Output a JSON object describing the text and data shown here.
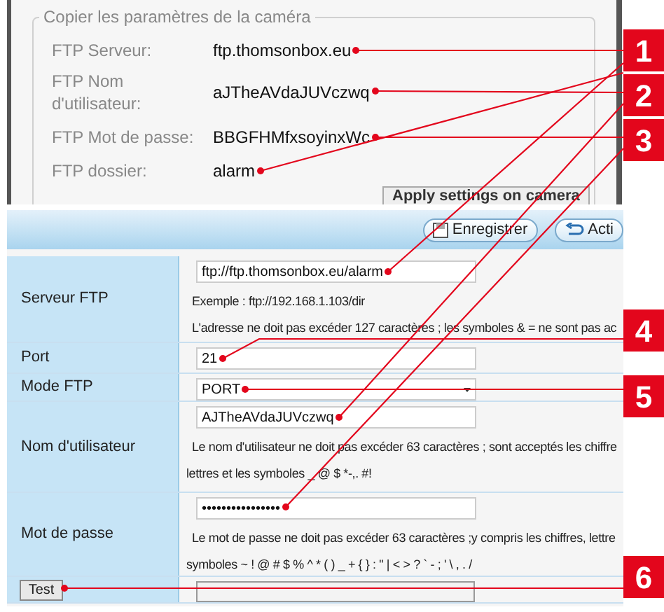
{
  "copy_panel": {
    "legend": "Copier les paramètres de la caméra",
    "rows": [
      {
        "label": "FTP Serveur:",
        "value": "ftp.thomsonbox.eu"
      },
      {
        "label": "FTP Nom d'utilisateur:",
        "value": "aJTheAVdaJUVczwq"
      },
      {
        "label": "FTP Mot de passe:",
        "value": "BBGFHMfxsoyinxWc"
      },
      {
        "label": "FTP dossier:",
        "value": "alarm"
      }
    ],
    "apply_button": "Apply settings on camera"
  },
  "settings": {
    "toolbar": [
      {
        "label": "Enregistrer",
        "kind": "save"
      },
      {
        "label": "Acti",
        "kind": "back"
      }
    ],
    "rows": [
      {
        "kind": "text",
        "label": "Serveur FTP",
        "value": "ftp://ftp.thomsonbox.eu/alarm",
        "hints": [
          "Exemple : ftp://192.168.1.103/dir",
          "L'adresse ne doit pas excéder 127 caractères ; les symboles & = ne sont pas ac"
        ]
      },
      {
        "kind": "text",
        "label": "Port",
        "value": "21",
        "hints": []
      },
      {
        "kind": "select",
        "label": "Mode FTP",
        "value": "PORT",
        "hints": []
      },
      {
        "kind": "text",
        "label": "Nom d'utilisateur",
        "value": "AJTheAVdaJUVczwq",
        "hints": [
          "Le nom d'utilisateur ne doit pas excéder 63 caractères ; sont acceptés les chiffre",
          "lettres et les symboles _ @ $ *-,. #!"
        ]
      },
      {
        "kind": "text",
        "label": "Mot de passe",
        "value": "••••••••••••••••",
        "hints": [
          "Le mot de passe ne doit pas excéder 63 caractères ;y compris les chiffres, lettre",
          "symboles ~ ! @ # $ % ^ * ( ) _ + { } : \" | < > ? ` - ; ' \\ , . /"
        ]
      },
      {
        "kind": "test",
        "button": "Test",
        "value": ""
      }
    ]
  },
  "callouts": [
    "1",
    "2",
    "3",
    "4",
    "5",
    "6"
  ]
}
